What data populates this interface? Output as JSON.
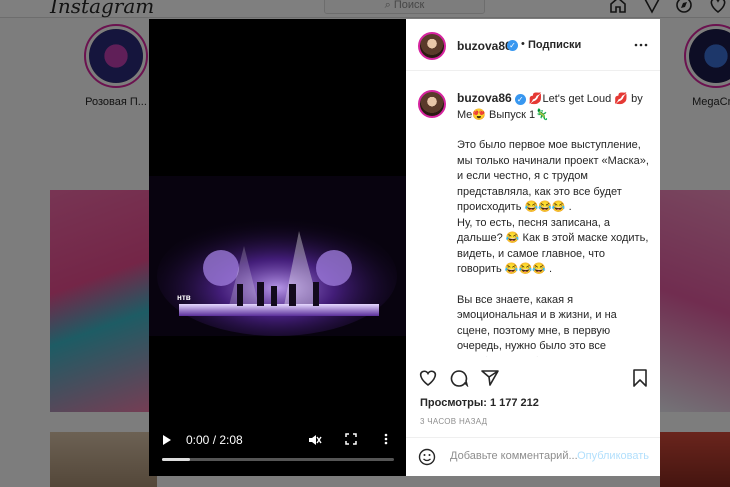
{
  "background": {
    "logo": "Instagram",
    "search_placeholder": "Поиск",
    "stories": [
      {
        "label": "Розовая П..."
      },
      {
        "label": "MegaCno"
      }
    ]
  },
  "video": {
    "time": "0:00 / 2:08",
    "progress": 0.12,
    "watermark": "нтв"
  },
  "post": {
    "username": "buzova86",
    "follow_separator": "•",
    "follow_label": "Подписки",
    "caption_title": "💋Let's get Loud 💋 by Me😍 Выпуск 1🦎",
    "paragraphs": [
      "Это было первое мое выступление, мы только начинали проект «Маска», и если честно, я с трудом представляла, как это все будет происходить 😂😂😂 .",
      "Ну, то есть, песня записана, а дальше? 😂 Как в этой маске ходить, видеть, и самое главное, что говорить 😂😂😂 .",
      "",
      "Вы все знаете, какая я эмоциональная и в жизни, и на сцене, поэтому мне, в первую очередь, нужно было это все «прибрать», и быть немного медленней 🐢 И мне сразу удалось запутать жюри, после этого номера"
    ],
    "views_label": "Просмотры: 1 177 212",
    "time_ago": "3 ЧАСОВ НАЗАД",
    "comment_placeholder": "Добавьте комментарий...",
    "post_button": "Опубликовать"
  },
  "colors": {
    "accent": "#3897f0",
    "post_disabled": "#b2dffc"
  }
}
